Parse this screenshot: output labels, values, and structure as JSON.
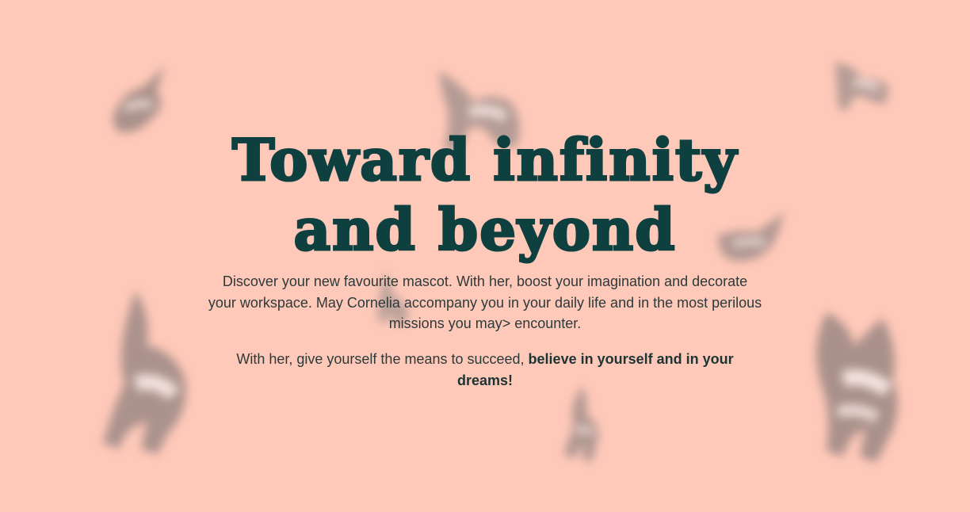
{
  "theme": {
    "background": "#ffc9b9",
    "title_color": "#0f4040",
    "text_color": "#2c3a3a"
  },
  "background_decor": {
    "icon": "blurred-unicorn-figures"
  },
  "hero": {
    "title_line1": "Toward infinity",
    "title_line2": "and beyond",
    "paragraph1": "Discover your new favourite mascot. With her, boost your imagination and decorate your workspace. May Cornelia accompany you in your daily life and in the most perilous missions you may> encounter.",
    "paragraph2_lead": "With her, give yourself the means to succeed, ",
    "paragraph2_emphasis": "believe in yourself and in your dreams!"
  }
}
